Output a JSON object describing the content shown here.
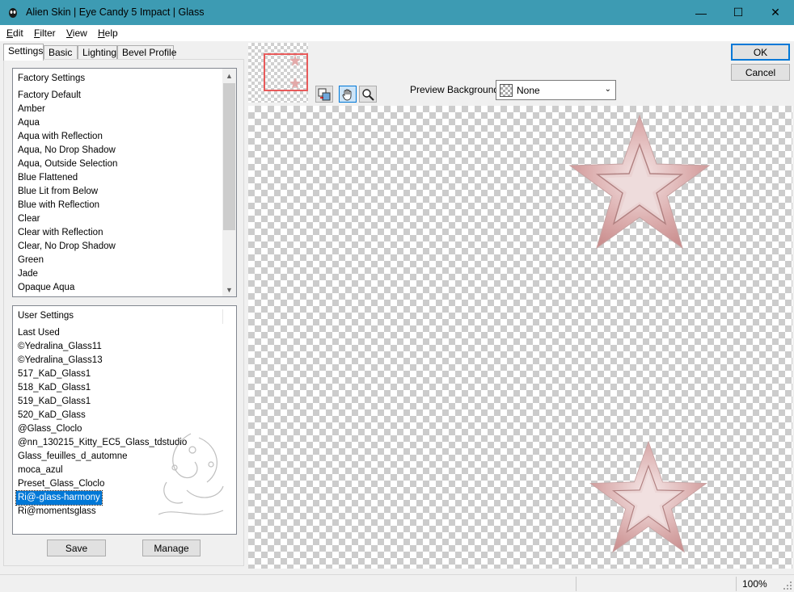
{
  "window": {
    "title": "Alien Skin | Eye Candy 5 Impact | Glass",
    "app_icon": "alien-head-icon",
    "minimize_glyph": "—",
    "maximize_glyph": "☐",
    "close_glyph": "✕"
  },
  "menu": {
    "edit": {
      "mnemonic": "E",
      "rest": "dit"
    },
    "filter": {
      "mnemonic": "F",
      "rest": "ilter"
    },
    "view": {
      "mnemonic": "V",
      "rest": "iew"
    },
    "help": {
      "mnemonic": "H",
      "rest": "elp"
    }
  },
  "tabs": [
    "Settings",
    "Basic",
    "Lighting",
    "Bevel Profile"
  ],
  "factory_settings": {
    "header": "Factory Settings",
    "items": [
      "Factory Default",
      "Amber",
      "Aqua",
      "Aqua with Reflection",
      "Aqua, No Drop Shadow",
      "Aqua, Outside Selection",
      "Blue Flattened",
      "Blue Lit from Below",
      "Blue with Reflection",
      "Clear",
      "Clear with Reflection",
      "Clear, No Drop Shadow",
      "Green",
      "Jade",
      "Opaque Aqua"
    ]
  },
  "user_settings": {
    "header": "User Settings",
    "items": [
      "Last Used",
      "©Yedralina_Glass11",
      "©Yedralina_Glass13",
      "517_KaD_Glass1",
      "518_KaD_Glass1",
      "519_KaD_Glass1",
      "520_KaD_Glass",
      "@Glass_Cloclo",
      "@nn_130215_Kitty_EC5_Glass_tdstudio",
      "Glass_feuilles_d_automne",
      "moca_azul",
      "Preset_Glass_Cloclo",
      "Ri@-glass-harmony",
      "Ri@momentsglass"
    ],
    "selected": "Ri@-glass-harmony"
  },
  "buttons": {
    "save": "Save",
    "manage": "Manage",
    "ok": "OK",
    "cancel": "Cancel"
  },
  "preview_background": {
    "label": "Preview Background:",
    "value": "None"
  },
  "status": {
    "zoom": "100%"
  },
  "colors": {
    "titlebar": "#3d9bb3",
    "selection": "#0078d7",
    "star_fill": "#d9a5a5",
    "nav_frame": "#e85a5a"
  }
}
